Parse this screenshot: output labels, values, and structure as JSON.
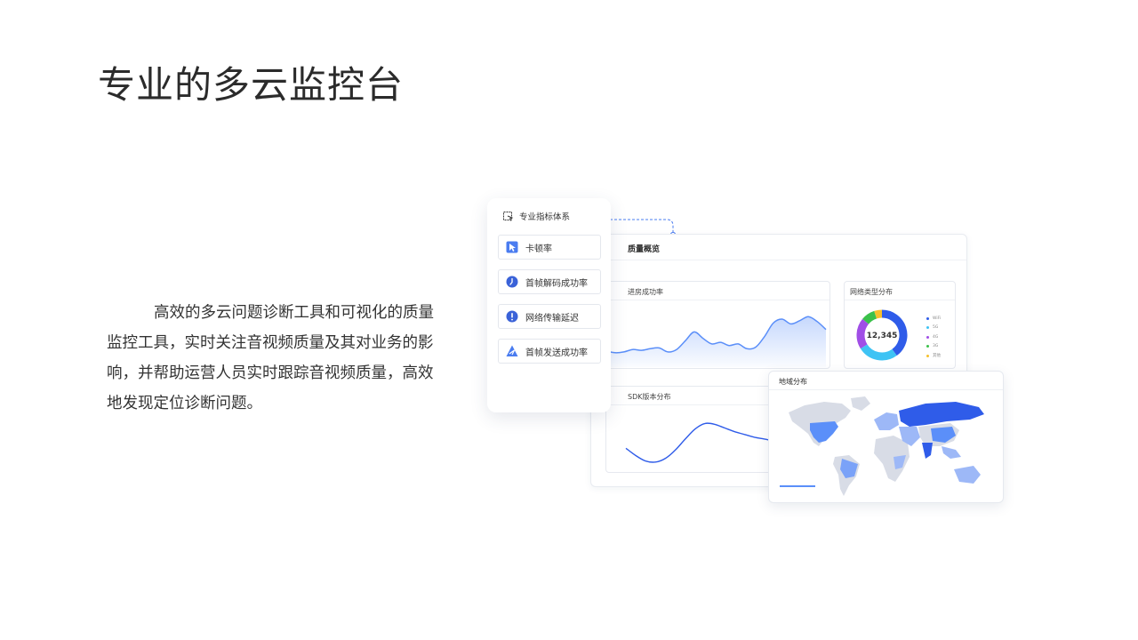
{
  "slide": {
    "title": "专业的多云监控台",
    "description": "高效的多云问题诊断工具和可视化的质量监控工具，实时关注音视频质量及其对业务的影响，并帮助运营人员实时跟踪音视频质量，高效地发现定位诊断问题。"
  },
  "dashboard": {
    "title": "质量概览",
    "panels": {
      "join_success": {
        "title": "进房成功率"
      },
      "network_type": {
        "title": "网络类型分布",
        "total": "12,345",
        "legend": [
          {
            "label": "WiFi",
            "color": "#2f5ce9"
          },
          {
            "label": "5G",
            "color": "#3ec3f4"
          },
          {
            "label": "4G",
            "color": "#a04ee6"
          },
          {
            "label": "3G",
            "color": "#3bc14a"
          },
          {
            "label": "其他",
            "color": "#f6c02c"
          }
        ]
      },
      "sdk_version": {
        "title": "SDK版本分布"
      }
    },
    "map": {
      "title": "地域分布"
    }
  },
  "metrics": {
    "title": "专业指标体系",
    "items": [
      {
        "label": "卡顿率",
        "icon": "video-stutter-icon"
      },
      {
        "label": "首帧解码成功率",
        "icon": "timer-icon"
      },
      {
        "label": "网络传输延迟",
        "icon": "alert-icon"
      },
      {
        "label": "首帧发送成功率",
        "icon": "send-icon"
      }
    ]
  },
  "colors": {
    "accent": "#2f5ce9",
    "line": "#5b8ff9",
    "card_border": "#e6e9ef"
  },
  "chart_data": [
    {
      "type": "area",
      "title": "进房成功率",
      "x": [
        0,
        1,
        2,
        3,
        4,
        5,
        6,
        7,
        8,
        9,
        10,
        11,
        12,
        13,
        14,
        15,
        16,
        17,
        18,
        19,
        20,
        21,
        22,
        23,
        24,
        25
      ],
      "values": [
        20,
        18,
        19,
        22,
        21,
        23,
        24,
        19,
        22,
        33,
        44,
        36,
        29,
        31,
        27,
        29,
        23,
        25,
        38,
        55,
        60,
        54,
        58,
        63,
        57,
        47
      ]
    },
    {
      "type": "pie",
      "title": "网络类型分布",
      "categories": [
        "WiFi",
        "5G",
        "4G",
        "3G",
        "其他"
      ],
      "values": [
        40,
        26,
        20,
        9,
        5
      ]
    },
    {
      "type": "line",
      "title": "SDK版本分布",
      "x": [
        0,
        1,
        2,
        3,
        4,
        5,
        6,
        7,
        8,
        9,
        10,
        11,
        12,
        13,
        14,
        15,
        16
      ],
      "values": [
        22,
        14,
        8,
        7,
        11,
        20,
        32,
        43,
        49,
        48,
        44,
        40,
        37,
        34,
        32,
        30,
        29
      ]
    }
  ]
}
